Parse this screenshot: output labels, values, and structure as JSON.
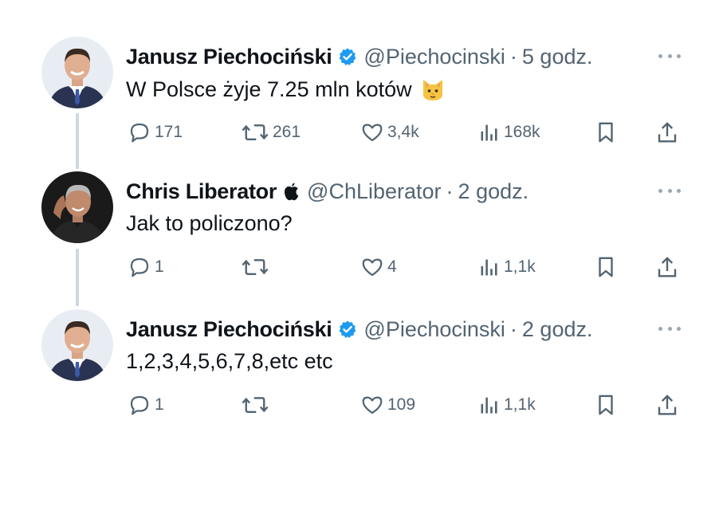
{
  "tweets": [
    {
      "name": "Janusz Piechociński",
      "handle": "@Piechocinski",
      "time": "5 godz.",
      "text": "W Polsce żyje 7.25 mln kotów",
      "emoji": "cat-face-emoji",
      "replies": "171",
      "retweets": "261",
      "likes": "3,4k",
      "views": "168k",
      "badge": "verified-icon"
    },
    {
      "name": "Chris Liberator",
      "handle": "@ChLiberator",
      "time": "2 godz.",
      "text": "Jak to policzono?",
      "replies": "1",
      "retweets": "",
      "likes": "4",
      "views": "1,1k",
      "badge": "apple-icon"
    },
    {
      "name": "Janusz Piechociński",
      "handle": "@Piechocinski",
      "time": "2 godz.",
      "text": "1,2,3,4,5,6,7,8,etc etc",
      "replies": "1",
      "retweets": "",
      "likes": "109",
      "views": "1,1k",
      "badge": "verified-icon"
    }
  ],
  "separator": "·",
  "colors": {
    "text": "#0f1419",
    "secondary": "#536471",
    "verified": "#1d9bf0",
    "thread_line": "#cfd9de"
  }
}
